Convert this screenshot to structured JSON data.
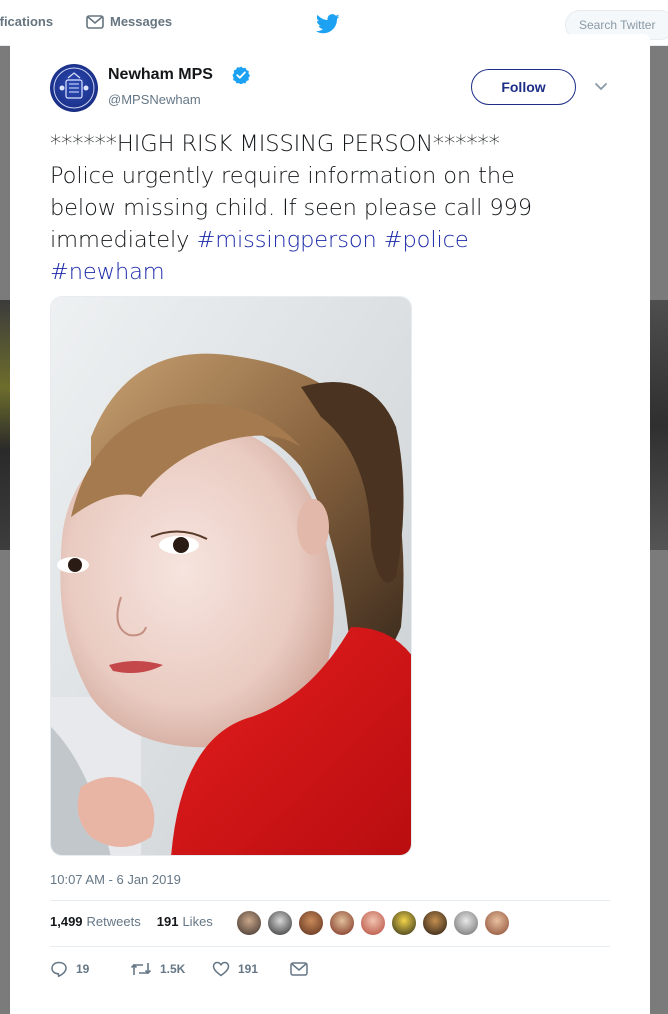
{
  "topbar": {
    "notifications_label": "ifications",
    "messages_label": "Messages",
    "search_placeholder": "Search Twitter"
  },
  "colors": {
    "link": "#1b2aa8",
    "follow": "#1d2e87",
    "secondary_text": "#657786",
    "verified": "#1da1f2"
  },
  "tweet": {
    "author": {
      "name": "Newham MPS",
      "handle": "@MPSNewham",
      "verified_icon": "verified-badge-icon"
    },
    "follow_label": "Follow",
    "text_lines": [
      "******HIGH RISK MISSING PERSON******",
      "Police urgently require information on the",
      "below missing child. If seen please call 999",
      "immediately "
    ],
    "hashtags": [
      "#missingperson",
      "#police",
      "#newham"
    ],
    "timestamp": "10:07 AM - 6 Jan 2019",
    "retweets_count": "1,499",
    "retweets_label": "Retweets",
    "likes_count": "191",
    "likes_label": "Likes",
    "actions": {
      "reply_count": "19",
      "retweet_count": "1.5K",
      "like_count": "191"
    }
  }
}
